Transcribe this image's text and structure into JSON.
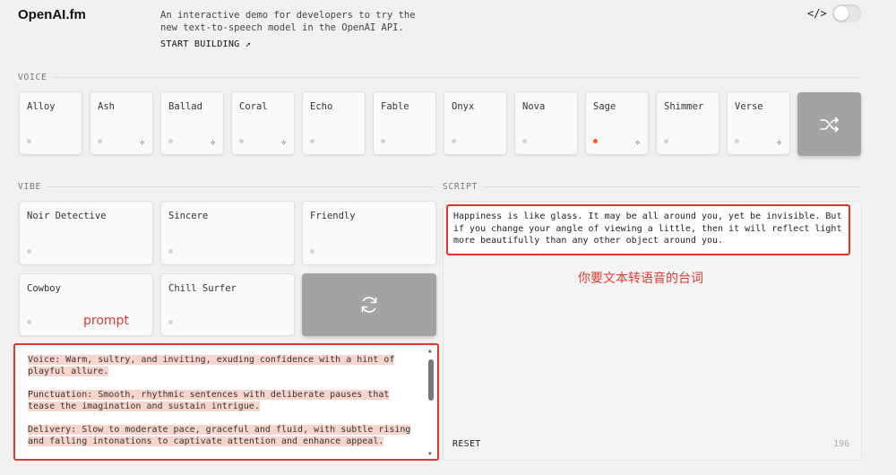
{
  "header": {
    "logo": "OpenAI.fm",
    "intro_line1": "An interactive demo for developers to try the",
    "intro_line2": "new text-to-speech model in the OpenAI API.",
    "start_building": "START BUILDING ↗",
    "code_toggle": "</>"
  },
  "voice": {
    "label": "VOICE",
    "items": [
      {
        "name": "Alloy"
      },
      {
        "name": "Ash"
      },
      {
        "name": "Ballad"
      },
      {
        "name": "Coral"
      },
      {
        "name": "Echo"
      },
      {
        "name": "Fable"
      },
      {
        "name": "Onyx"
      },
      {
        "name": "Nova"
      },
      {
        "name": "Sage"
      },
      {
        "name": "Shimmer"
      },
      {
        "name": "Verse"
      }
    ],
    "selected": "Sage"
  },
  "vibe": {
    "label": "VIBE",
    "items": [
      {
        "name": "Noir Detective"
      },
      {
        "name": "Sincere"
      },
      {
        "name": "Friendly"
      },
      {
        "name": "Cowboy"
      },
      {
        "name": "Chill Surfer"
      }
    ],
    "annotation": "prompt",
    "prompt_p1_l1": "Voice: Warm, sultry, and inviting, exuding confidence with a hint of",
    "prompt_p1_l2": "playful allure.",
    "prompt_p2_l1": "Punctuation: Smooth, rhythmic sentences with deliberate pauses that",
    "prompt_p2_l2": "tease the imagination and sustain intrigue.",
    "prompt_p3_l1": "Delivery: Slow to moderate pace, graceful and fluid, with subtle rising",
    "prompt_p3_l2": "and falling intonations to captivate attention and enhance appeal."
  },
  "script": {
    "label": "SCRIPT",
    "line1": "Happiness is like glass. It may be all around you, yet be invisible. But",
    "line2": "if you change your angle of viewing a little, then it will reflect light",
    "line3": "more beautifully than any other object around you.",
    "annotation": "你要文本转语音的台词",
    "reset": "RESET",
    "count": "196"
  },
  "colors": {
    "accent": "#ff5a1f",
    "annotation": "#e5322b"
  }
}
